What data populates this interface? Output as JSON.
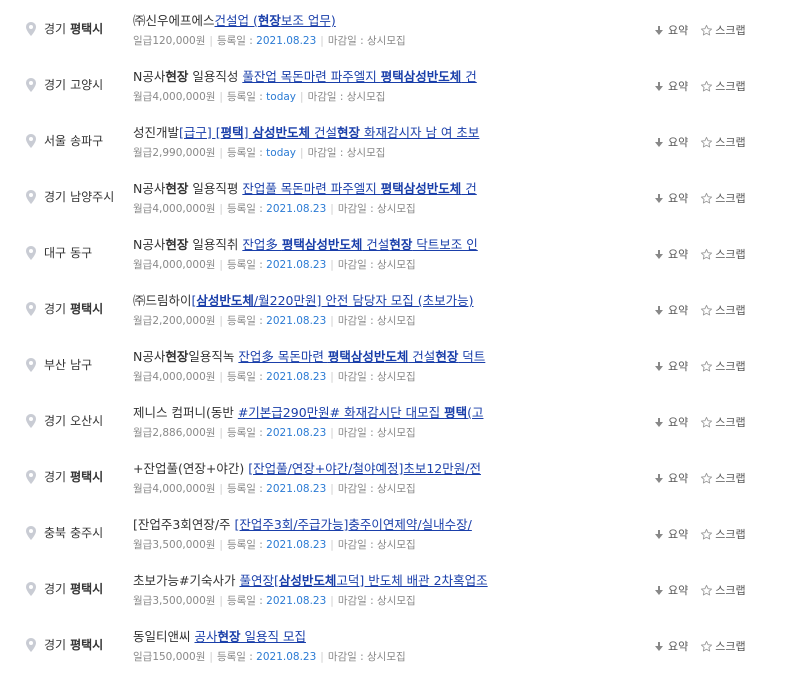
{
  "rows": [
    {
      "sido": "경기",
      "gu": "평택시",
      "gu_hl": true,
      "company": "㈜신우에프에스",
      "title": [
        {
          "t": "건설업 (",
          "b": false
        },
        {
          "t": "현장",
          "b": true
        },
        {
          "t": "보조 업무)",
          "b": false
        }
      ],
      "pay": "일급120,000원",
      "reg_label": "등록일 :",
      "reg_date": "2021.08.23",
      "dead_label": "마감일 : 상시모집"
    },
    {
      "sido": "경기",
      "gu": "고양시",
      "gu_hl": false,
      "company": "N공사",
      "company_parts": [
        {
          "t": "N공사",
          "b": false
        },
        {
          "t": "현장",
          "b": true
        },
        {
          "t": " 일용직성 ",
          "b": false
        }
      ],
      "title": [
        {
          "t": "풀잔업 목돈마련 파주엘지 ",
          "b": false
        },
        {
          "t": "평택삼성반도체",
          "b": true
        },
        {
          "t": " 건",
          "b": false
        }
      ],
      "pay": "월급4,000,000원",
      "reg_label": "등록일 :",
      "reg_date": "today",
      "dead_label": "마감일 : 상시모집"
    },
    {
      "sido": "서울",
      "gu": "송파구",
      "gu_hl": false,
      "company": "성진개발",
      "title": [
        {
          "t": "[급구] [",
          "b": false
        },
        {
          "t": "평택",
          "b": true
        },
        {
          "t": "] ",
          "b": false
        },
        {
          "t": "삼성반도체",
          "b": true
        },
        {
          "t": " 건설",
          "b": false
        },
        {
          "t": "현장",
          "b": true
        },
        {
          "t": " 화재감시자 남 여 초보",
          "b": false
        }
      ],
      "pay": "월급2,990,000원",
      "reg_label": "등록일 :",
      "reg_date": "today",
      "dead_label": "마감일 : 상시모집"
    },
    {
      "sido": "경기",
      "gu": "남양주시",
      "gu_hl": false,
      "company": "N공사",
      "company_parts": [
        {
          "t": "N공사",
          "b": false
        },
        {
          "t": "현장",
          "b": true
        },
        {
          "t": " 일용직평 ",
          "b": false
        }
      ],
      "title": [
        {
          "t": "잔업풀 목돈마련 파주엘지 ",
          "b": false
        },
        {
          "t": "평택삼성반도체",
          "b": true
        },
        {
          "t": " 건",
          "b": false
        }
      ],
      "pay": "월급4,000,000원",
      "reg_label": "등록일 :",
      "reg_date": "2021.08.23",
      "dead_label": "마감일 : 상시모집"
    },
    {
      "sido": "대구",
      "gu": "동구",
      "gu_hl": false,
      "company": "N공사",
      "company_parts": [
        {
          "t": "N공사",
          "b": false
        },
        {
          "t": "현장",
          "b": true
        },
        {
          "t": " 일용직취 ",
          "b": false
        }
      ],
      "title": [
        {
          "t": "잔업多 ",
          "b": false
        },
        {
          "t": "평택삼성반도체",
          "b": true
        },
        {
          "t": " 건설",
          "b": false
        },
        {
          "t": "현장",
          "b": true
        },
        {
          "t": " 닥트보조 인",
          "b": false
        }
      ],
      "pay": "월급4,000,000원",
      "reg_label": "등록일 :",
      "reg_date": "2021.08.23",
      "dead_label": "마감일 : 상시모집"
    },
    {
      "sido": "경기",
      "gu": "평택시",
      "gu_hl": true,
      "company": "㈜드림하이",
      "title": [
        {
          "t": "[",
          "b": false
        },
        {
          "t": "삼성반도체",
          "b": true
        },
        {
          "t": "/월220만원] 안전 담당자 모집 (초보가능)",
          "b": false
        }
      ],
      "pay": "월급2,200,000원",
      "reg_label": "등록일 :",
      "reg_date": "2021.08.23",
      "dead_label": "마감일 : 상시모집"
    },
    {
      "sido": "부산",
      "gu": "남구",
      "gu_hl": false,
      "company": "N공사",
      "company_parts": [
        {
          "t": "N공사",
          "b": false
        },
        {
          "t": "현장",
          "b": true
        },
        {
          "t": "일용직녹 ",
          "b": false
        }
      ],
      "title": [
        {
          "t": "잔업多 목돈마련 ",
          "b": false
        },
        {
          "t": "평택삼성반도체",
          "b": true
        },
        {
          "t": " 건설",
          "b": false
        },
        {
          "t": "현장",
          "b": true
        },
        {
          "t": " 덕트",
          "b": false
        }
      ],
      "pay": "월급4,000,000원",
      "reg_label": "등록일 :",
      "reg_date": "2021.08.23",
      "dead_label": "마감일 : 상시모집"
    },
    {
      "sido": "경기",
      "gu": "오산시",
      "gu_hl": false,
      "company": "제니스 컴퍼니(동반 ",
      "title": [
        {
          "t": "#기본급290만원# 화재감시단 대모집 ",
          "b": false
        },
        {
          "t": "평택",
          "b": true
        },
        {
          "t": "(고",
          "b": false
        }
      ],
      "pay": "월급2,886,000원",
      "reg_label": "등록일 :",
      "reg_date": "2021.08.23",
      "dead_label": "마감일 : 상시모집"
    },
    {
      "sido": "경기",
      "gu": "평택시",
      "gu_hl": true,
      "company": "+잔업풀(연장+야간) ",
      "title": [
        {
          "t": "[잔업풀/연장+야간/철야예정]초보12만원/전",
          "b": false
        }
      ],
      "pay": "월급4,000,000원",
      "reg_label": "등록일 :",
      "reg_date": "2021.08.23",
      "dead_label": "마감일 : 상시모집"
    },
    {
      "sido": "충북",
      "gu": "충주시",
      "gu_hl": false,
      "company": "[잔업주3회연장/주 ",
      "title": [
        {
          "t": "[잔업주3회/주급가능]충주이연제약/실내수장/",
          "b": false
        }
      ],
      "pay": "월급3,500,000원",
      "reg_label": "등록일 :",
      "reg_date": "2021.08.23",
      "dead_label": "마감일 : 상시모집"
    },
    {
      "sido": "경기",
      "gu": "평택시",
      "gu_hl": true,
      "company": "초보가능#기숙사가 ",
      "title": [
        {
          "t": "풀연장[",
          "b": false
        },
        {
          "t": "삼성반도체",
          "b": true
        },
        {
          "t": "고덕] 반도체 배관 2차혹업조",
          "b": false
        }
      ],
      "pay": "월급3,500,000원",
      "reg_label": "등록일 :",
      "reg_date": "2021.08.23",
      "dead_label": "마감일 : 상시모집"
    },
    {
      "sido": "경기",
      "gu": "평택시",
      "gu_hl": true,
      "company": "동일티앤씨 ",
      "title": [
        {
          "t": "공사",
          "b": false
        },
        {
          "t": "현장",
          "b": true
        },
        {
          "t": " 일용직 모집",
          "b": false
        }
      ],
      "pay": "일급150,000원",
      "reg_label": "등록일 :",
      "reg_date": "2021.08.23",
      "dead_label": "마감일 : 상시모집"
    }
  ],
  "actions": {
    "summary": "요약",
    "scrap": "스크랩"
  },
  "icons": {
    "location": "location-pin-icon",
    "summary": "down-arrow-icon",
    "scrap": "star-outline-icon"
  },
  "colors": {
    "link": "#1a3faa",
    "date": "#2b7bd4",
    "meta": "#888888",
    "pin": "#c9ccd4"
  }
}
